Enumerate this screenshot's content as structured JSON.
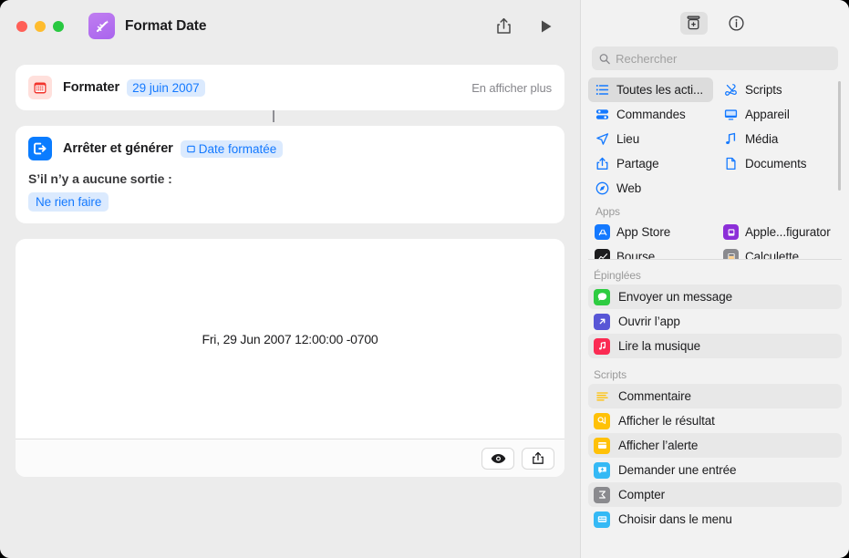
{
  "window": {
    "title": "Format Date",
    "app_icon": "shortcuts-icon",
    "traffic": {
      "close": "close-button",
      "minimize": "minimize-button",
      "zoom": "zoom-button"
    },
    "share_label": "share-icon",
    "run_label": "run-icon"
  },
  "editor": {
    "actions": [
      {
        "icon": "calendar-icon",
        "title": "Formater",
        "token": "29 juin 2007",
        "more": "En afficher plus"
      },
      {
        "icon": "stop-and-output-icon",
        "title": "Arrêter et générer",
        "token": "Date formatée",
        "sub_label": "S’il n’y a aucune sortie :",
        "chip": "Ne rien faire"
      }
    ],
    "preview": {
      "result_text": "Fri, 29 Jun 2007 12:00:00 -0700",
      "eye_button": "quick-look-icon",
      "share_button": "share-icon"
    }
  },
  "sidebar": {
    "toolbar": {
      "library_label": "action-library-icon",
      "info_label": "info-icon"
    },
    "search": {
      "placeholder": "Rechercher",
      "value": "",
      "icon": "search-icon"
    },
    "categories": [
      {
        "label": "Toutes les acti...",
        "icon": "list-icon",
        "selected": true,
        "color": "#1479ff"
      },
      {
        "label": "Scripts",
        "icon": "scripts-icon",
        "selected": false,
        "color": "#1479ff"
      },
      {
        "label": "Commandes",
        "icon": "controls-icon",
        "selected": false,
        "color": "#1479ff"
      },
      {
        "label": "Appareil",
        "icon": "device-icon",
        "selected": false,
        "color": "#1479ff"
      },
      {
        "label": "Lieu",
        "icon": "location-icon",
        "selected": false,
        "color": "#1479ff"
      },
      {
        "label": "Média",
        "icon": "media-icon",
        "selected": false,
        "color": "#1479ff"
      },
      {
        "label": "Partage",
        "icon": "share-icon",
        "selected": false,
        "color": "#1479ff"
      },
      {
        "label": "Documents",
        "icon": "document-icon",
        "selected": false,
        "color": "#1479ff"
      },
      {
        "label": "Web",
        "icon": "web-icon",
        "selected": false,
        "color": "#1479ff"
      }
    ],
    "apps_header": "Apps",
    "apps": [
      {
        "label": "App Store",
        "icon": "app-store-icon",
        "color": "#1479ff"
      },
      {
        "label": "Apple...figurator",
        "icon": "apple-configurator-icon",
        "color": "#8c2fd8"
      },
      {
        "label": "Bourse",
        "icon": "stocks-icon",
        "color": "#1c1c1e"
      },
      {
        "label": "Calculette",
        "icon": "calculator-icon",
        "color": "#8a8a8e"
      }
    ],
    "pinned_header": "Épinglées",
    "pinned": [
      {
        "label": "Envoyer un message",
        "icon": "messages-icon",
        "color": "#2ecc41"
      },
      {
        "label": "Ouvrir l’app",
        "icon": "open-app-icon",
        "color": "#5856d6"
      },
      {
        "label": "Lire la musique",
        "icon": "music-icon",
        "color": "#fb2b53"
      }
    ],
    "scripts_header": "Scripts",
    "scripts": [
      {
        "label": "Commentaire",
        "icon": "comment-icon",
        "color": "#ffffff"
      },
      {
        "label": "Afficher le résultat",
        "icon": "show-result-icon",
        "color": "#ffc107"
      },
      {
        "label": "Afficher l’alerte",
        "icon": "show-alert-icon",
        "color": "#ffc107"
      },
      {
        "label": "Demander une entrée",
        "icon": "ask-for-input-icon",
        "color": "#35b9f5"
      },
      {
        "label": "Compter",
        "icon": "count-icon",
        "color": "#8a8a8e"
      },
      {
        "label": "Choisir dans le menu",
        "icon": "choose-from-menu-icon",
        "color": "#35b9f5"
      }
    ]
  },
  "colors": {
    "accent": "#1479ff",
    "token_bg": "#dbeafe",
    "window_bg": "#ececec",
    "sidebar_bg": "#f2f2f2"
  }
}
